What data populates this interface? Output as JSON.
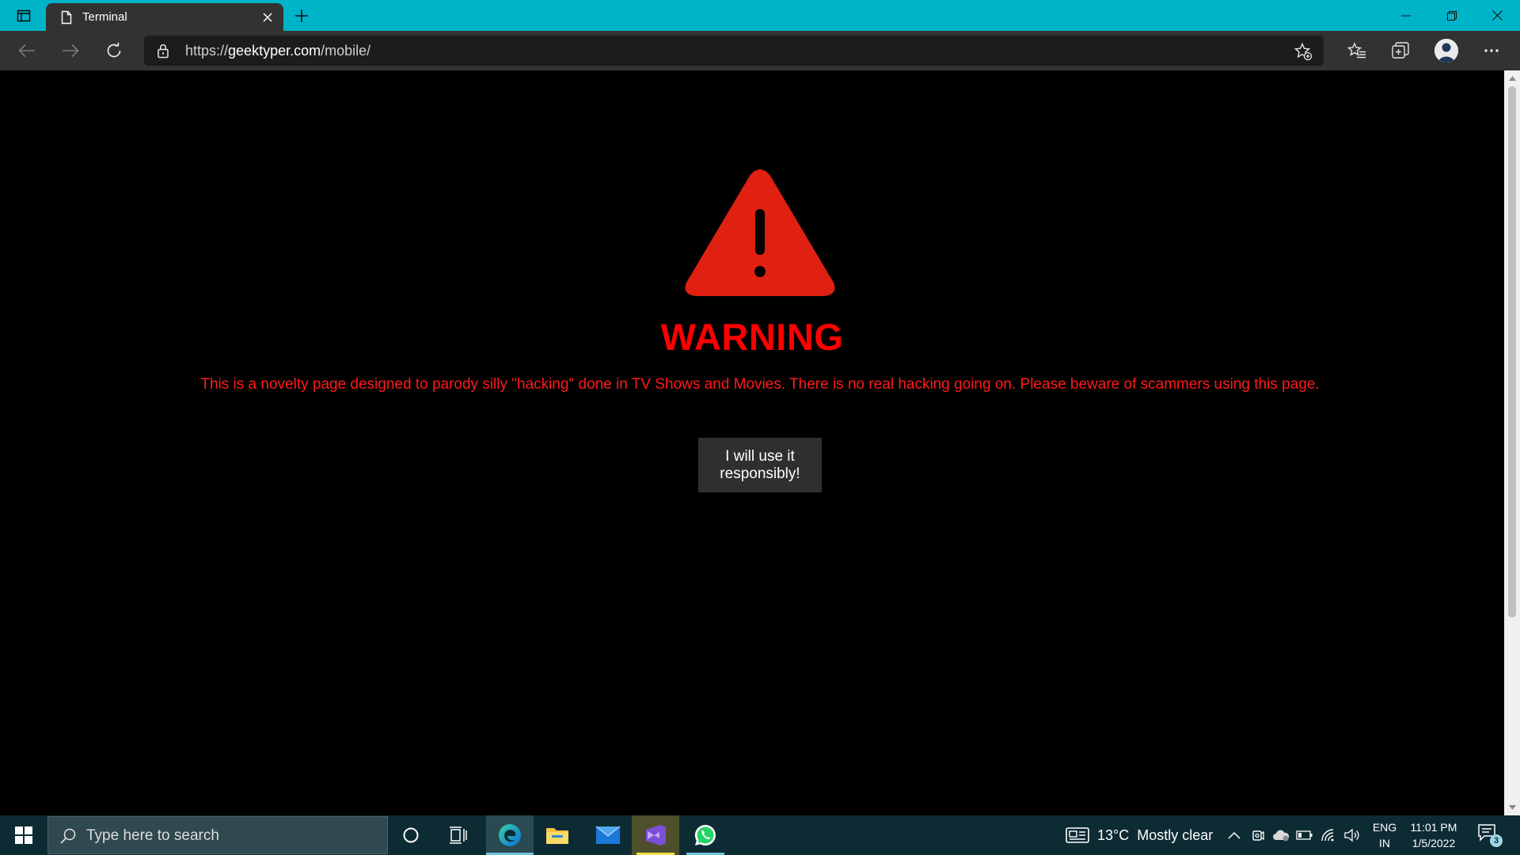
{
  "browser": {
    "tab_title": "Terminal",
    "url_scheme": "https://",
    "url_domain": "geektyper.com",
    "url_path": "/mobile/"
  },
  "page": {
    "warning_title": "WARNING",
    "warning_message": "This is a novelty page designed to parody silly \"hacking\" done in TV Shows and Movies. There is no real hacking going on. Please beware of scammers using this page.",
    "agree_button_label": "I will use it responsibly!"
  },
  "taskbar": {
    "search_placeholder": "Type here to search",
    "weather_temp": "13°C",
    "weather_desc": "Mostly clear",
    "lang_line1": "ENG",
    "lang_line2": "IN",
    "time": "11:01 PM",
    "date": "1/5/2022",
    "notification_count": "3"
  },
  "colors": {
    "titlebar": "#00b4c8",
    "toolbar": "#323232",
    "warning_red": "#ff0000",
    "taskbar": "#0d2b33"
  }
}
